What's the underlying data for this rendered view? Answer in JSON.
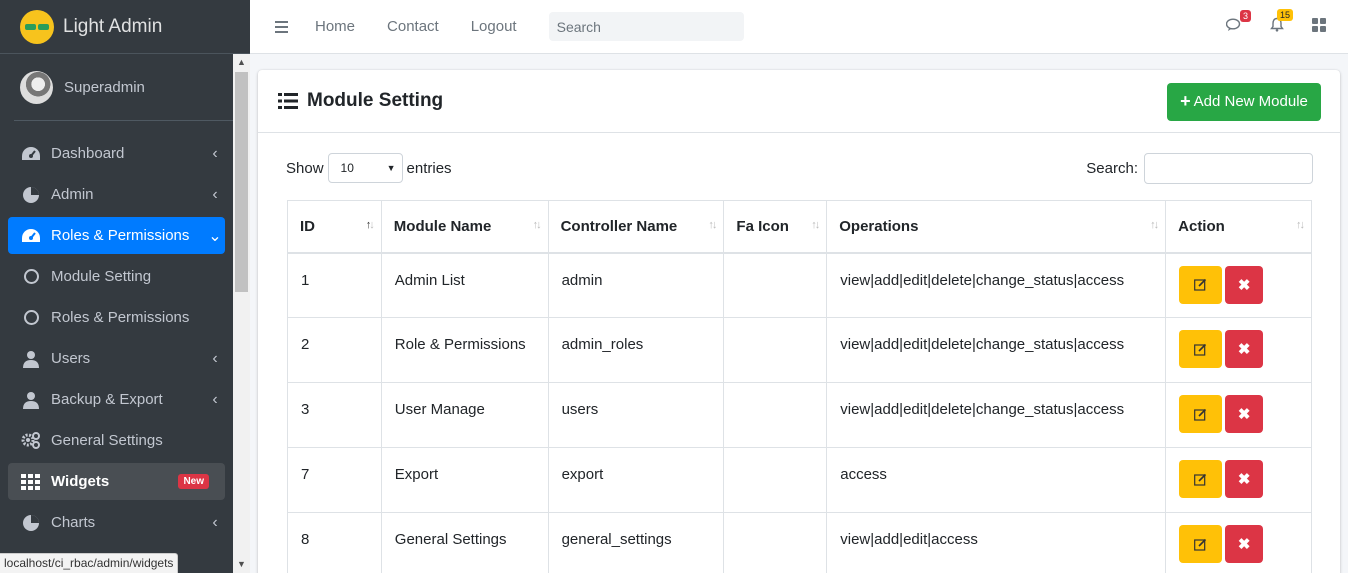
{
  "brand": {
    "title": "Light Admin"
  },
  "user": {
    "name": "Superadmin"
  },
  "sidebar": {
    "items": [
      {
        "label": "Dashboard",
        "icon": "tachometer-icon",
        "chevron": "‹"
      },
      {
        "label": "Admin",
        "icon": "pie-chart-icon",
        "chevron": "‹"
      },
      {
        "label": "Roles & Permissions",
        "icon": "tachometer-icon",
        "chevron": "⌄"
      },
      {
        "label": "Module Setting",
        "icon": "circle-icon"
      },
      {
        "label": "Roles & Permissions",
        "icon": "circle-icon"
      },
      {
        "label": "Users",
        "icon": "user-icon",
        "chevron": "‹"
      },
      {
        "label": "Backup & Export",
        "icon": "user-icon",
        "chevron": "‹"
      },
      {
        "label": "General Settings",
        "icon": "gears-icon"
      },
      {
        "label": "Widgets",
        "icon": "grid-icon",
        "badge": "New"
      },
      {
        "label": "Charts",
        "icon": "pie-chart-icon",
        "chevron": "‹"
      }
    ]
  },
  "status_url": "localhost/ci_rbac/admin/widgets",
  "topbar": {
    "links": [
      "Home",
      "Contact",
      "Logout"
    ],
    "search_placeholder": "Search",
    "messages_count": "3",
    "notifications_count": "15"
  },
  "card": {
    "title": "Module Setting",
    "add_button": "Add New Module",
    "show_label": "Show",
    "entries_value": "10",
    "entries_label": "entries",
    "search_label": "Search:"
  },
  "table": {
    "headers": [
      "ID",
      "Module Name",
      "Controller Name",
      "Fa Icon",
      "Operations",
      "Action"
    ],
    "rows": [
      {
        "id": "1",
        "module": "Admin List",
        "controller": "admin",
        "fa": "",
        "ops": "view|add|edit|delete|change_status|access"
      },
      {
        "id": "2",
        "module": "Role & Permissions",
        "controller": "admin_roles",
        "fa": "",
        "ops": "view|add|edit|delete|change_status|access"
      },
      {
        "id": "3",
        "module": "User Manage",
        "controller": "users",
        "fa": "",
        "ops": "view|add|edit|delete|change_status|access"
      },
      {
        "id": "7",
        "module": "Export",
        "controller": "export",
        "fa": "",
        "ops": "access"
      },
      {
        "id": "8",
        "module": "General Settings",
        "controller": "general_settings",
        "fa": "",
        "ops": "view|add|edit|access"
      }
    ]
  },
  "colors": {
    "primary": "#007bff",
    "success": "#28a745",
    "warning": "#ffc107",
    "danger": "#dc3545",
    "sidebar": "#343a40"
  }
}
